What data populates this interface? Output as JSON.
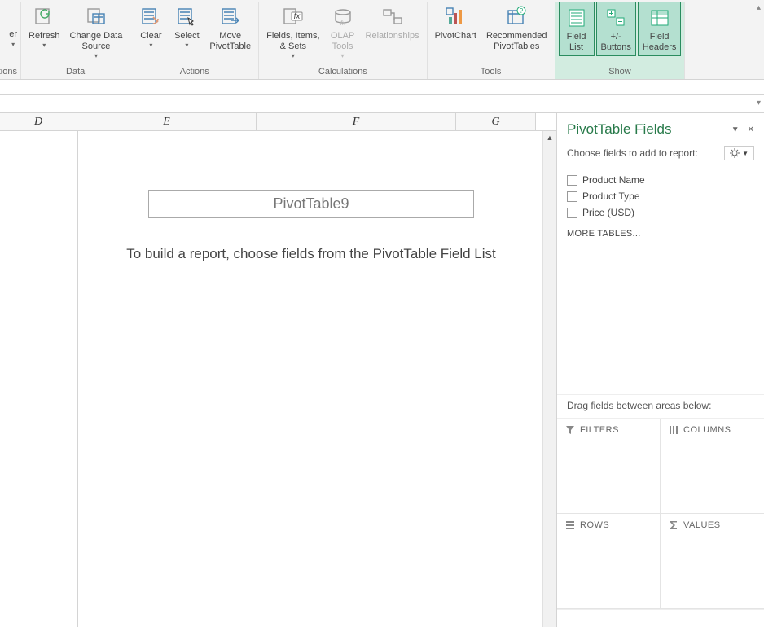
{
  "ribbon": {
    "partial_group1_label": "ctions",
    "partial_button_label": "er",
    "refresh": "Refresh",
    "change_data_source": "Change Data\nSource",
    "data_group": "Data",
    "clear": "Clear",
    "select": "Select",
    "move": "Move\nPivotTable",
    "actions_group": "Actions",
    "fields_items_sets": "Fields, Items,\n& Sets",
    "olap_tools": "OLAP\nTools",
    "relationships": "Relationships",
    "calc_group": "Calculations",
    "pivotchart": "PivotChart",
    "recommended": "Recommended\nPivotTables",
    "tools_group": "Tools",
    "field_list": "Field\nList",
    "pm_buttons": "+/-\nButtons",
    "field_headers": "Field\nHeaders",
    "show_group": "Show"
  },
  "columns": {
    "d": "D",
    "e": "E",
    "f": "F",
    "g": "G"
  },
  "pivot": {
    "name": "PivotTable9",
    "instruction": "To build a report, choose fields from the PivotTable Field List"
  },
  "pane": {
    "title": "PivotTable Fields",
    "subtitle": "Choose fields to add to report:",
    "fields": {
      "f1": "Product Name",
      "f2": "Product Type",
      "f3": "Price (USD)"
    },
    "more_tables": "MORE TABLES...",
    "drag_label": "Drag fields between areas below:",
    "area_filters": "FILTERS",
    "area_columns": "COLUMNS",
    "area_rows": "ROWS",
    "area_values": "VALUES"
  }
}
